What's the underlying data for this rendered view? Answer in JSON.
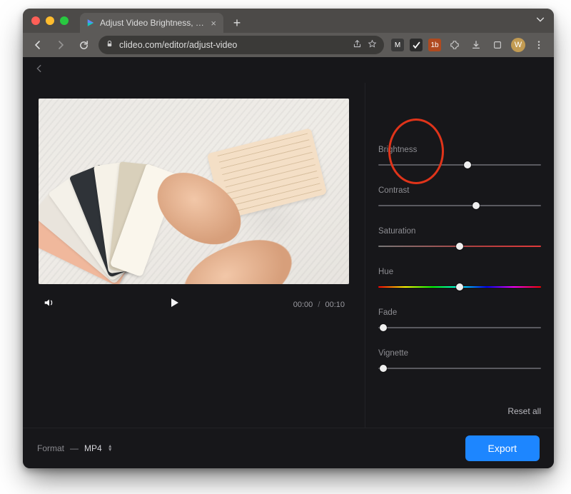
{
  "browser": {
    "tab_title": "Adjust Video Brightness, Cont",
    "url": "clideo.com/editor/adjust-video",
    "avatar_initial": "W"
  },
  "player": {
    "current_time": "00:00",
    "duration": "00:10",
    "time_sep": "/"
  },
  "adjustments": {
    "brightness": {
      "label": "Brightness",
      "percent": 55
    },
    "contrast": {
      "label": "Contrast",
      "percent": 60
    },
    "saturation": {
      "label": "Saturation",
      "percent": 50
    },
    "hue": {
      "label": "Hue",
      "percent": 50
    },
    "fade": {
      "label": "Fade",
      "percent": 3
    },
    "vignette": {
      "label": "Vignette",
      "percent": 3
    }
  },
  "sidebar": {
    "reset_label": "Reset all"
  },
  "footer": {
    "format_label": "Format",
    "format_dash": "—",
    "format_value": "MP4",
    "export_label": "Export"
  }
}
